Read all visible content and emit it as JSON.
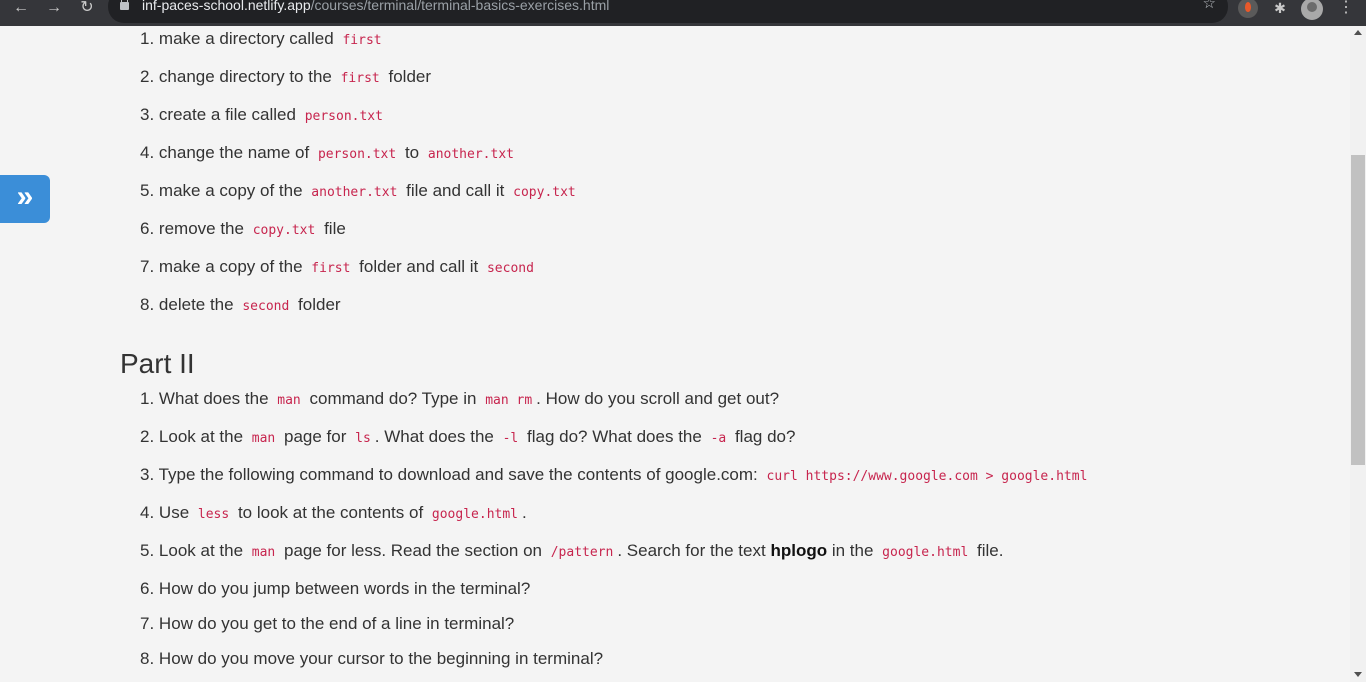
{
  "browser": {
    "url_host": "inf-paces-school.netlify.app",
    "url_path": "/courses/terminal/terminal-basics-exercises.html",
    "back_icon": "←",
    "forward_icon": "→",
    "reload_icon": "↻",
    "star_icon": "☆",
    "puzzle_icon": "✱",
    "menu_icon": "⋮"
  },
  "sidebar_toggle": {
    "icon": "»"
  },
  "part1": {
    "steps": [
      {
        "num": "1.",
        "t1": "make a directory called",
        "c1": "first"
      },
      {
        "num": "2.",
        "t1": "change directory to the",
        "c1": "first",
        "t2": "folder"
      },
      {
        "num": "3.",
        "t1": "create a file called",
        "c1": "person.txt"
      },
      {
        "num": "4.",
        "t1": "change the name of",
        "c1": "person.txt",
        "t2": "to",
        "c2": "another.txt"
      },
      {
        "num": "5.",
        "t1": "make a copy of the",
        "c1": "another.txt",
        "t2": "file and call it",
        "c2": "copy.txt"
      },
      {
        "num": "6.",
        "t1": "remove the",
        "c1": "copy.txt",
        "t2": "file"
      },
      {
        "num": "7.",
        "t1": "make a copy of the",
        "c1": "first",
        "t2": "folder and call it",
        "c2": "second"
      },
      {
        "num": "8.",
        "t1": "delete the",
        "c1": "second",
        "t2": "folder"
      }
    ]
  },
  "part2": {
    "heading": "Part II",
    "steps": [
      {
        "num": "1.",
        "t1": "What does the",
        "c1": "man",
        "t2": "command do? Type in",
        "c2": "man rm",
        "t3": ". How do you scroll and get out?"
      },
      {
        "num": "2.",
        "t1": "Look at the",
        "c1": "man",
        "t2": "page for",
        "c2": "ls",
        "t3": ". What does the",
        "c3": "-l",
        "t4": "flag do? What does the",
        "c4": "-a",
        "t5": "flag do?"
      },
      {
        "num": "3.",
        "t1": "Type the following command to download and save the contents of google.com:",
        "c1": "curl https://www.google.com > google.html"
      },
      {
        "num": "4.",
        "t1": "Use",
        "c1": "less",
        "t2": "to look at the contents of",
        "c2": "google.html",
        "t3": "."
      },
      {
        "num": "5.",
        "t1": "Look at the",
        "c1": "man",
        "t2": "page for less. Read the section on",
        "c2": "/pattern",
        "t3": ". Search for the text",
        "b1": "hplogo",
        "t4": "in the",
        "c3": "google.html",
        "t5": "file."
      },
      {
        "num": "6.",
        "t1": "How do you jump between words in the terminal?"
      },
      {
        "num": "7.",
        "t1": "How do you get to the end of a line in terminal?"
      },
      {
        "num": "8.",
        "t1": "How do you move your cursor to the beginning in terminal?"
      }
    ]
  }
}
